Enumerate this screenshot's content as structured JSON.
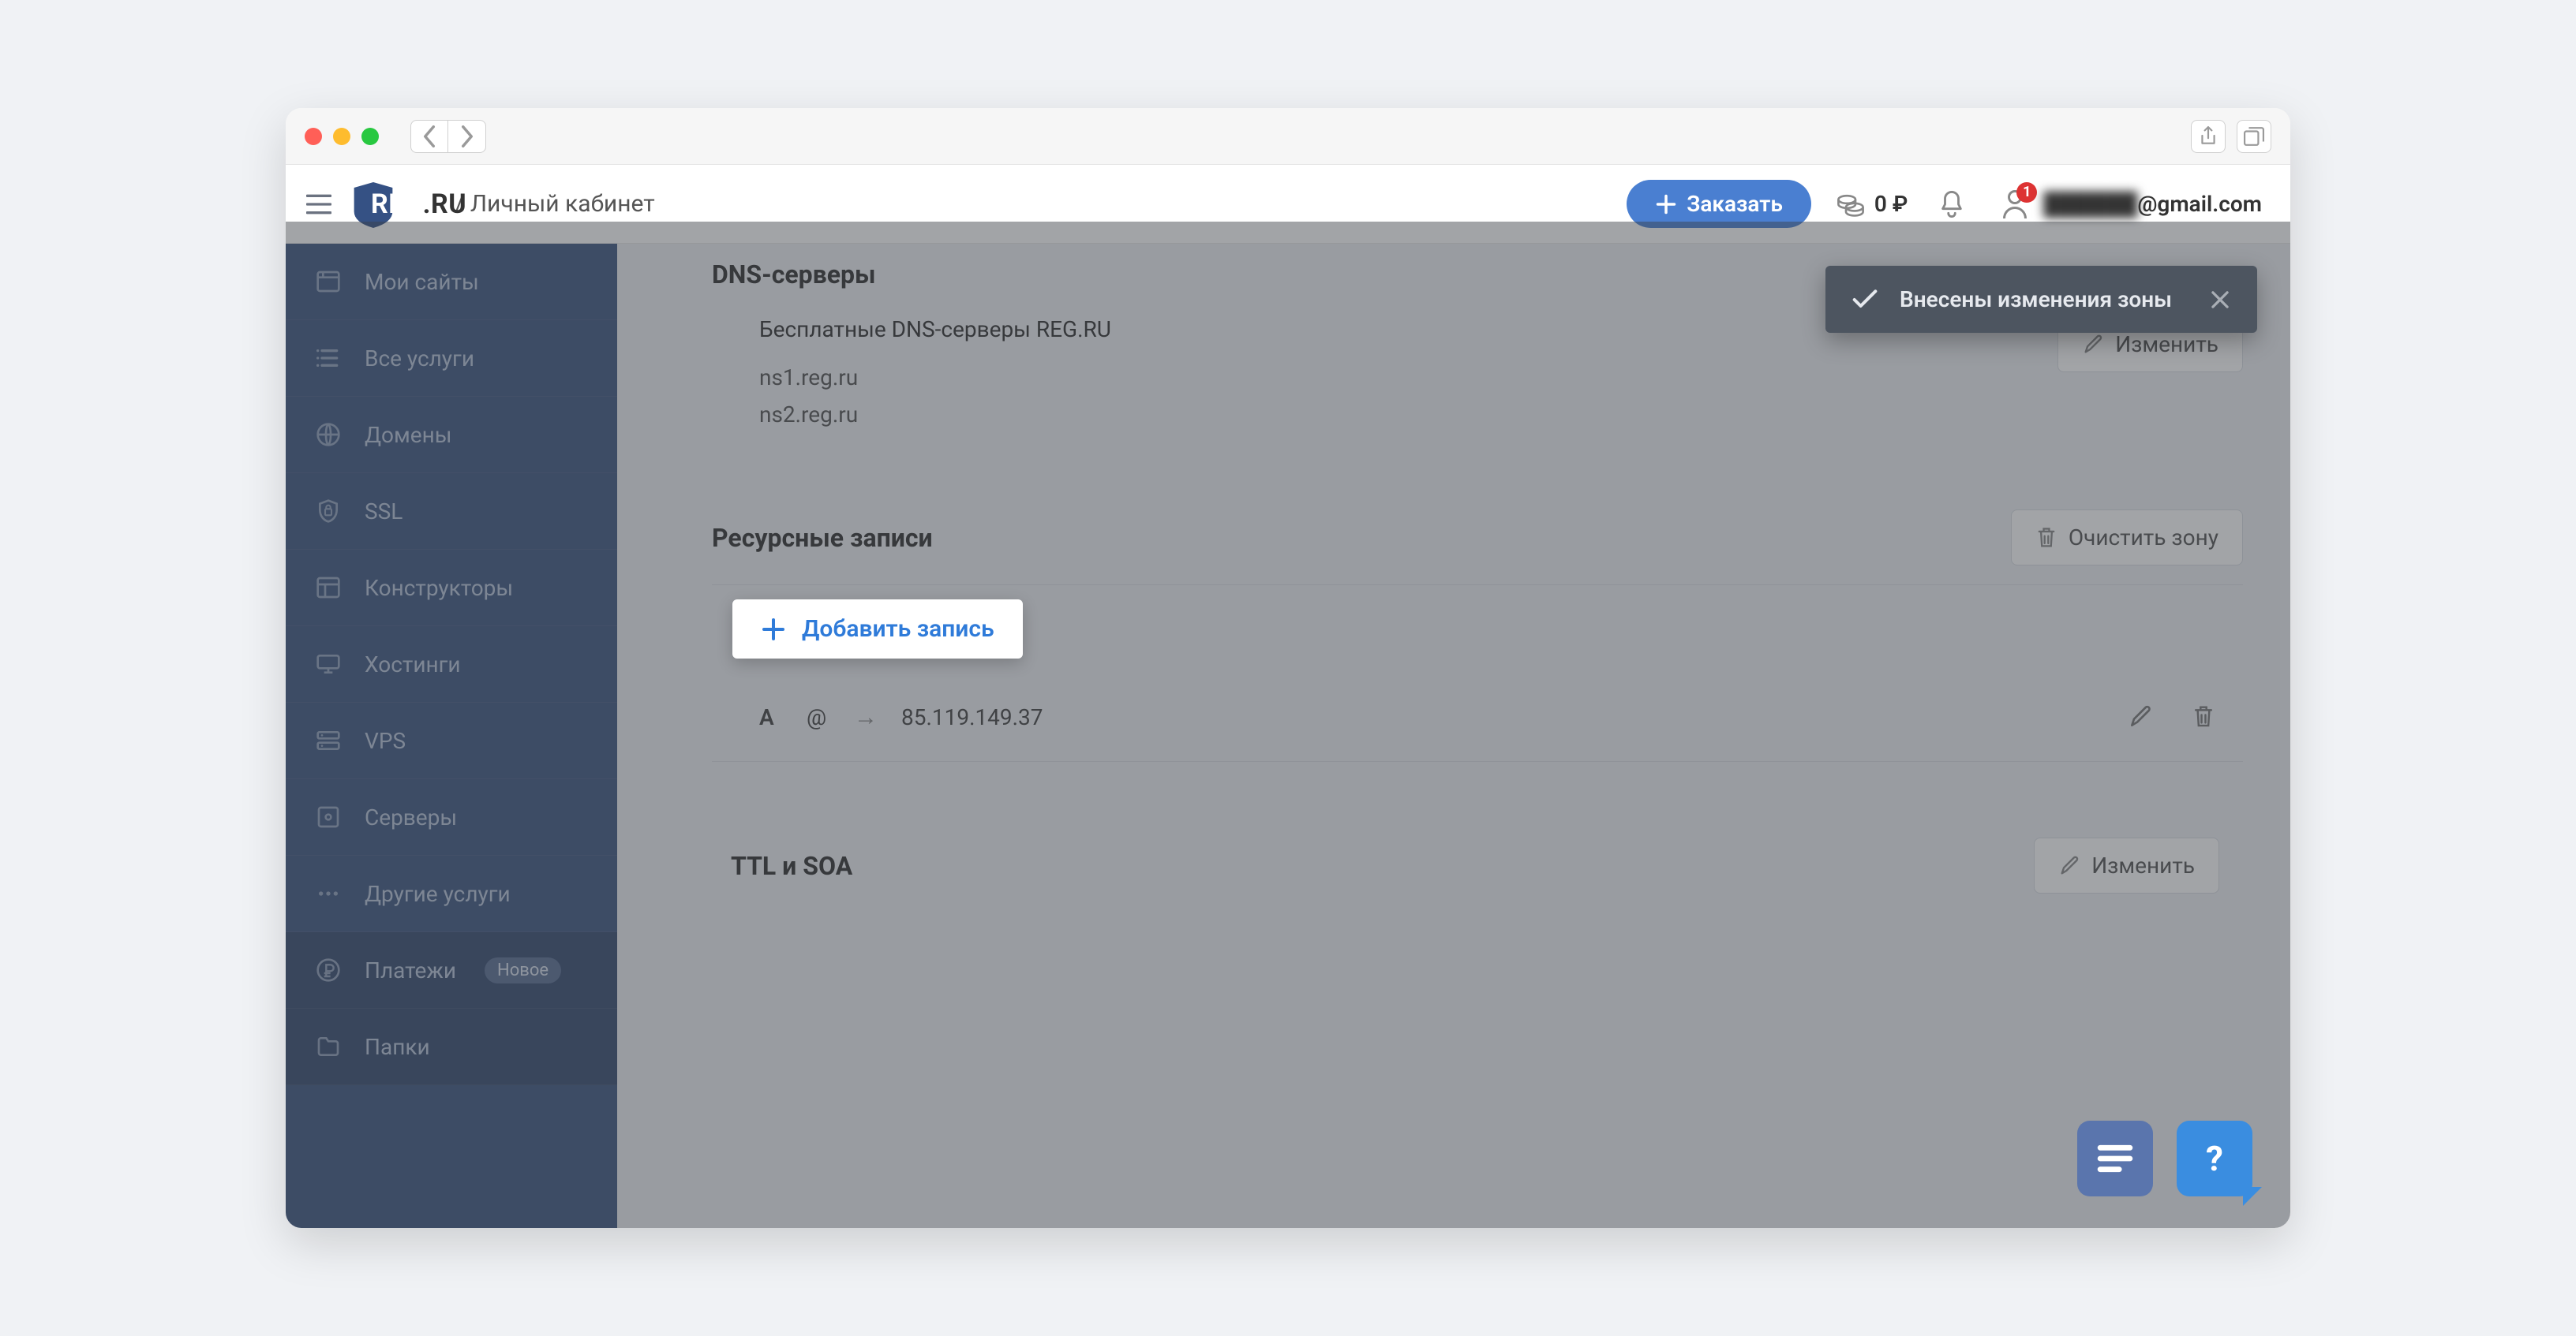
{
  "browser": {
    "share_tooltip": "Share",
    "tabs_tooltip": "Tabs"
  },
  "logo": {
    "reg": "REG",
    "ru": ".RU"
  },
  "breadcrumb": "/ Личный кабинет",
  "order_button": "Заказать",
  "balance": "0 ₽",
  "user": {
    "email_hidden": "██████",
    "email_domain": "@gmail.com",
    "notification_count": "1"
  },
  "sidebar": {
    "items": [
      {
        "label": "Мои сайты"
      },
      {
        "label": "Все услуги"
      },
      {
        "label": "Домены"
      },
      {
        "label": "SSL"
      },
      {
        "label": "Конструкторы"
      },
      {
        "label": "Хостинги"
      },
      {
        "label": "VPS"
      },
      {
        "label": "Серверы"
      },
      {
        "label": "Другие услуги"
      },
      {
        "label": "Платежи",
        "badge": "Новое"
      },
      {
        "label": "Папки"
      }
    ]
  },
  "dns": {
    "title": "DNS-серверы",
    "subtitle": "Бесплатные DNS-серверы REG.RU",
    "ns1": "ns1.reg.ru",
    "ns2": "ns2.reg.ru",
    "edit": "Изменить"
  },
  "records": {
    "title": "Ресурсные записи",
    "clear": "Очистить зону",
    "add": "Добавить запись",
    "row": {
      "type": "A",
      "name": "@",
      "arrow": "→",
      "value": "85.119.149.37"
    }
  },
  "ttl": {
    "title": "TTL и SOA",
    "edit": "Изменить"
  },
  "toast": {
    "message": "Внесены изменения зоны"
  },
  "help": {
    "question": "?"
  }
}
